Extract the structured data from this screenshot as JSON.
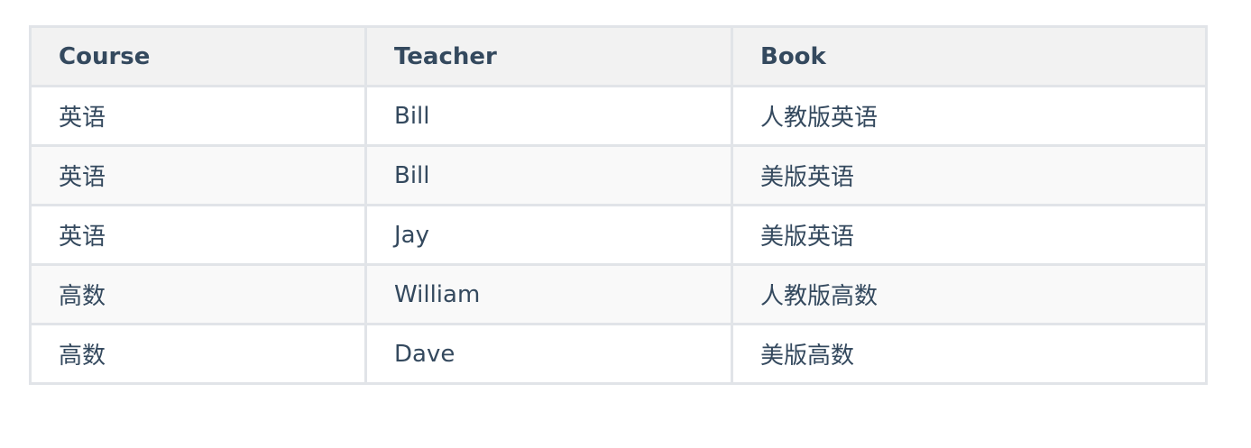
{
  "table": {
    "headers": [
      "Course",
      "Teacher",
      "Book"
    ],
    "rows": [
      [
        "英语",
        "Bill",
        "人教版英语"
      ],
      [
        "英语",
        "Bill",
        "美版英语"
      ],
      [
        "英语",
        "Jay",
        "美版英语"
      ],
      [
        "高数",
        "William",
        "人教版高数"
      ],
      [
        "高数",
        "Dave",
        "美版高数"
      ]
    ]
  }
}
